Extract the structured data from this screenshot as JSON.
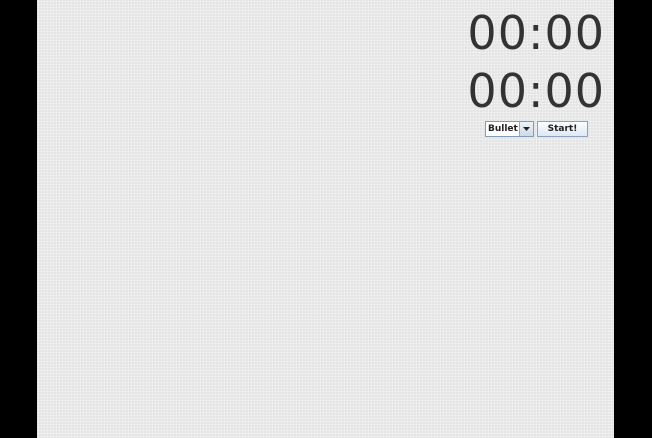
{
  "timers": {
    "primary": "00:00",
    "secondary": "00:00"
  },
  "controls": {
    "mode_select": {
      "selected": "Bullet"
    },
    "start_label": "Start!"
  },
  "colors": {
    "frame": "#000000",
    "panel_background": "#e9e9e9",
    "timer_text": "#333333"
  },
  "icons": {
    "dropdown": "chevron-down-icon"
  }
}
